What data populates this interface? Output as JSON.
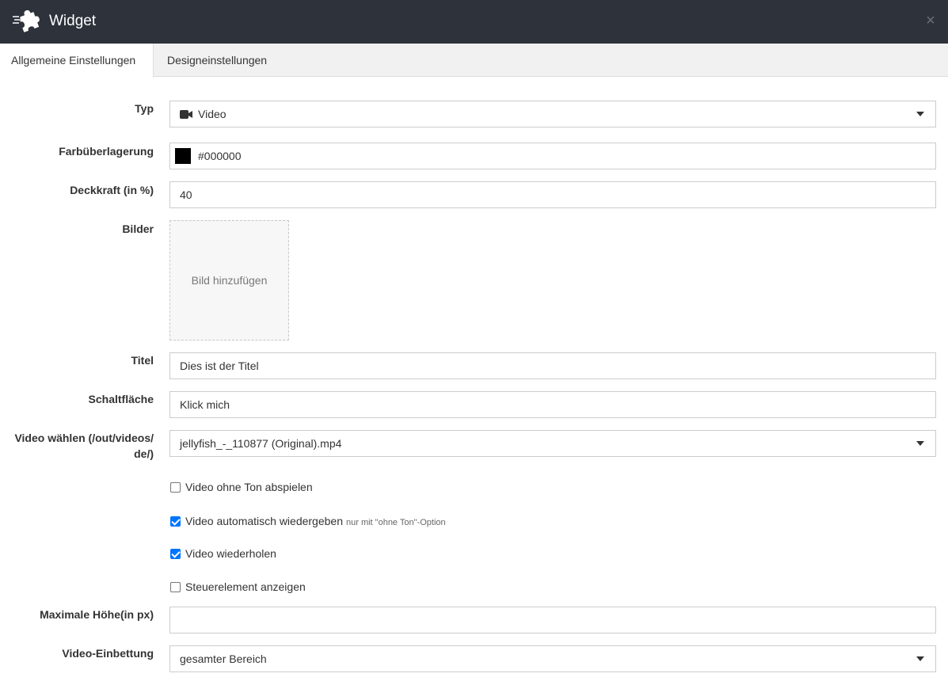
{
  "header": {
    "title": "Widget",
    "close_label": "×"
  },
  "tabs": [
    {
      "label": "Allgemeine Einstellungen",
      "active": true
    },
    {
      "label": "Designeinstellungen",
      "active": false
    }
  ],
  "form": {
    "typ": {
      "label": "Typ",
      "value": "Video",
      "icon": "video-camera-icon"
    },
    "farbe": {
      "label": "Farbüberlagerung",
      "value": "#000000",
      "swatch_color": "#000000"
    },
    "deckkraft": {
      "label": "Deckkraft (in %)",
      "value": "40"
    },
    "bilder": {
      "label": "Bilder",
      "add_label": "Bild hinzufügen"
    },
    "titel": {
      "label": "Titel",
      "value": "Dies ist der Titel"
    },
    "schaltflaeche": {
      "label": "Schaltfläche",
      "value": "Klick mich"
    },
    "video": {
      "label_line1": "Video wählen (/out/videos/",
      "label_line2": "de/)",
      "value": "jellyfish_-_110877 (Original).mp4"
    },
    "checkboxes": [
      {
        "label": "Video ohne Ton abspielen",
        "checked": false,
        "hint": ""
      },
      {
        "label": "Video automatisch wiedergeben",
        "checked": true,
        "hint": "nur mit \"ohne Ton\"-Option"
      },
      {
        "label": "Video wiederholen",
        "checked": true,
        "hint": ""
      },
      {
        "label": "Steuerelement anzeigen",
        "checked": false,
        "hint": ""
      }
    ],
    "max_hoehe": {
      "label": "Maximale Höhe(in px)",
      "value": ""
    },
    "einbettung": {
      "label": "Video-Einbettung",
      "value": "gesamter Bereich"
    }
  },
  "colors": {
    "header_bg": "#2d323b",
    "checkbox_checked": "#0075ff",
    "tabs_bg": "#f1f1f1"
  }
}
